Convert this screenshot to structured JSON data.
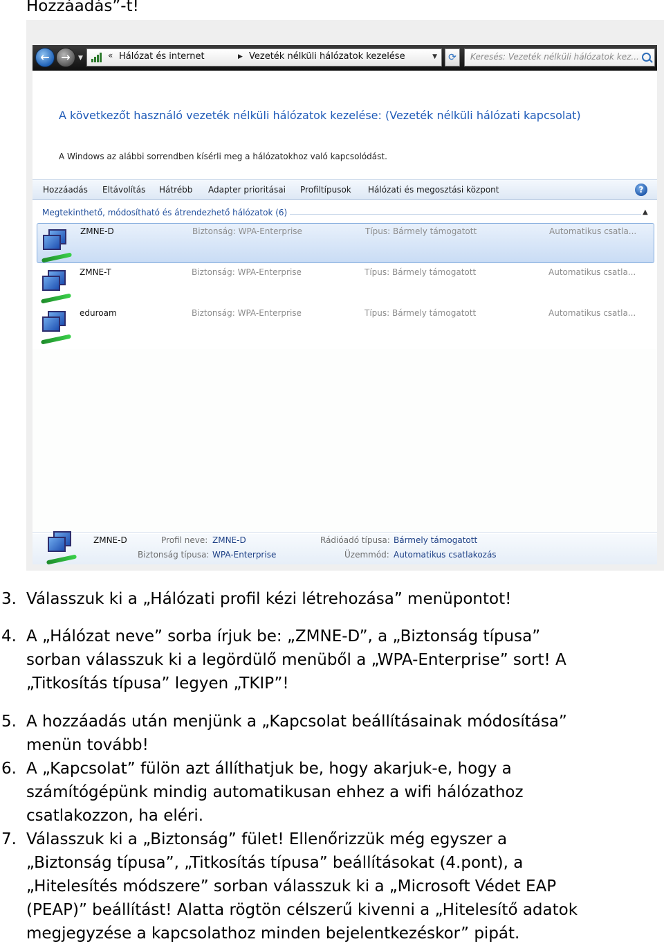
{
  "top_text": "Hozzáadás”-t!",
  "window": {
    "address": {
      "segment_1": "Hálózat és internet",
      "segment_2": "Vezeték nélküli hálózatok kezelése",
      "search_placeholder": "Keresés: Vezeték nélküli hálózatok kez..."
    },
    "heading": "A következőt használó vezeték nélküli hálózatok kezelése: (Vezeték nélküli hálózati kapcsolat)",
    "subheading": "A Windows az alábbi sorrendben kísérli meg a hálózatokhoz való kapcsolódást.",
    "toolbar": [
      "Hozzáadás",
      "Eltávolítás",
      "Hátrébb",
      "Adapter prioritásai",
      "Profiltípusok",
      "Hálózati és megosztási központ"
    ],
    "group_title": "Megtekinthető, módosítható és átrendezhető hálózatok (6)",
    "networks": [
      {
        "name": "ZMNE-D",
        "security": "Biztonság:  WPA-Enterprise",
        "type": "Típus:  Bármely támogatott",
        "mode": "Automatikus csatla..."
      },
      {
        "name": "ZMNE-T",
        "security": "Biztonság:  WPA-Enterprise",
        "type": "Típus:  Bármely támogatott",
        "mode": "Automatikus csatla..."
      },
      {
        "name": "eduroam",
        "security": "Biztonság:  WPA-Enterprise",
        "type": "Típus:  Bármely támogatott",
        "mode": "Automatikus csatla..."
      }
    ],
    "details": {
      "name": "ZMNE-D",
      "profile_label": "Profil neve:",
      "profile_value": "ZMNE-D",
      "security_label": "Biztonság típusa:",
      "security_value": "WPA-Enterprise",
      "radio_label": "Rádióadó típusa:",
      "radio_value": "Bármely támogatott",
      "mode_label": "Üzemmód:",
      "mode_value": "Automatikus csatlakozás"
    }
  },
  "steps": [
    {
      "num": "3.",
      "text": "Válasszuk ki a „Hálózati profil kézi létrehozása” menüpontot!"
    },
    {
      "num": "4.",
      "text": "A „Hálózat neve” sorba írjuk be: „ZMNE-D”, a „Biztonság típusa”\nsorban válasszuk ki a legördülő menüből a „WPA-Enterprise” sort! A\n„Titkosítás típusa” legyen „TKIP”!"
    },
    {
      "num": "5.",
      "text": "A hozzáadás után menjünk a „Kapcsolat beállításainak módosítása”\nmenün tovább!"
    },
    {
      "num": "6.",
      "text": "A „Kapcsolat” fülön azt állíthatjuk be, hogy akarjuk-e, hogy a\nszámítógépünk mindig automatikusan ehhez a wifi hálózathoz\ncsatlakozzon, ha eléri."
    },
    {
      "num": "7.",
      "text": "Válasszuk ki a „Biztonság” fület! Ellenőrizzük még egyszer a\n„Biztonság típusa”, „Titkosítás típusa” beállításokat (4.pont), a\n„Hitelesítés módszere” sorban válasszuk ki a „Microsoft Védet  EAP\n(PEAP)” beállítást! Alatta rögtön célszerű kivenni a „Hitelesítő adatok\nmegjegyzése a kapcsolathoz minden bejelentkezéskor” pipát."
    }
  ]
}
